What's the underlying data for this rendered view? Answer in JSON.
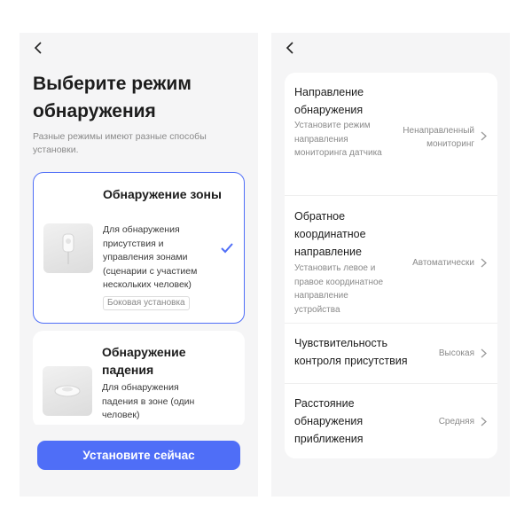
{
  "left_screen": {
    "title": "Выберите режим обнаружения",
    "subtitle": "Разные режимы имеют разные способы установки.",
    "modes": [
      {
        "title": "Обнаружение зоны",
        "description": "Для обнаружения присутствия и управления зонами (сценарии с участием нескольких человек)",
        "tag": "Боковая установка",
        "selected": true
      },
      {
        "title": "Обнаружение падения",
        "description": "Для обнаружения падения в зоне (один человек)",
        "selected": false
      }
    ],
    "primary_button": "Установите сейчас",
    "accent_color": "#4f6ef7"
  },
  "right_screen": {
    "settings": [
      {
        "title": "Направление обнаружения",
        "description": "Установите режим направления мониторинга датчика",
        "value": "Ненаправленный мониторинг"
      },
      {
        "title": "Обратное координатное направление",
        "description": "Установить левое и правое координатное направление устройства",
        "value": "Автоматически"
      },
      {
        "title": "Чувствительность контроля присутствия",
        "value": "Высокая"
      },
      {
        "title": "Расстояние обнаружения приближения",
        "value": "Средняя"
      }
    ]
  },
  "icons": {
    "back": "back-arrow-icon",
    "check": "check-icon",
    "chevron": "chevron-right-icon"
  }
}
